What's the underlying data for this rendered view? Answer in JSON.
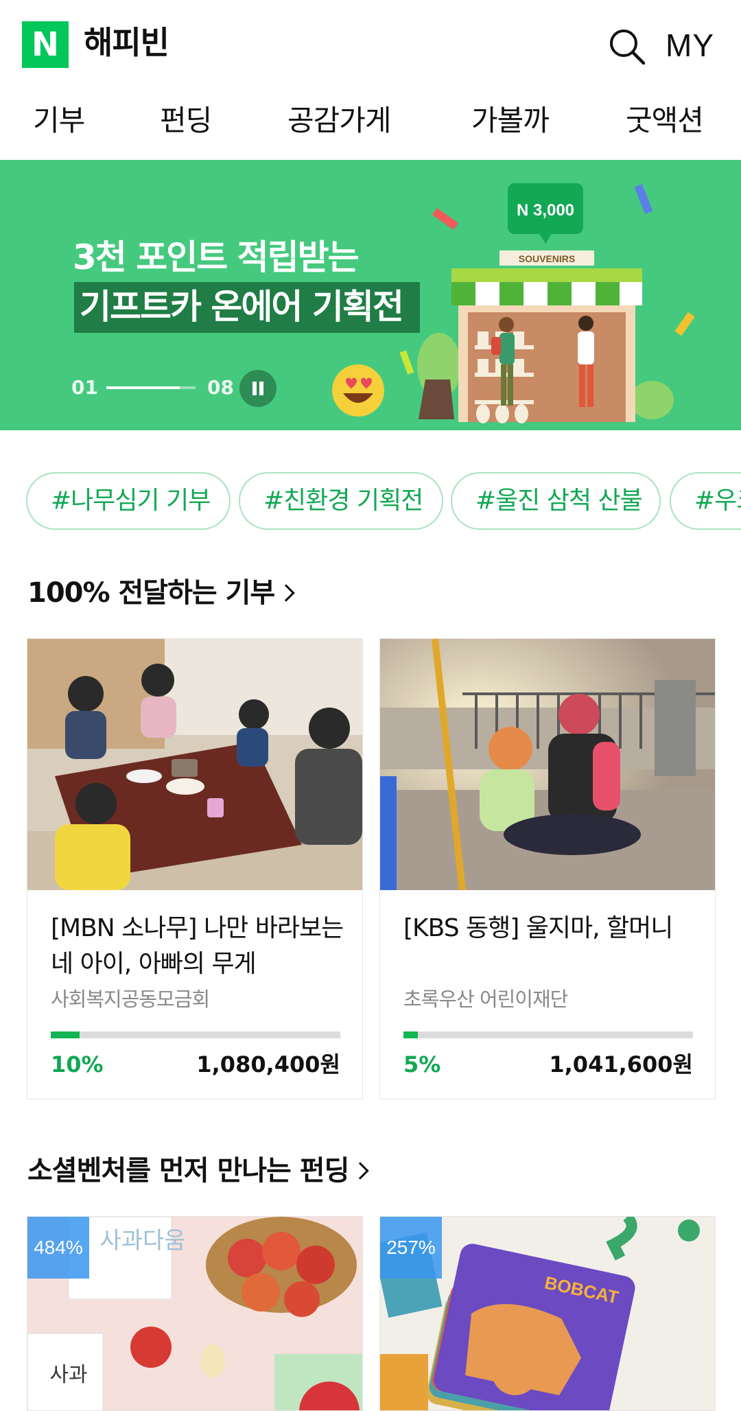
{
  "header": {
    "logo_letter": "N",
    "brand": "해피빈",
    "my_label": "MY",
    "brand_color": "#03c75a"
  },
  "nav": {
    "items": [
      "기부",
      "펀딩",
      "공감가게",
      "가볼까",
      "굿액션"
    ]
  },
  "banner": {
    "line1": "3천 포인트 적립받는",
    "line2": "기프트카 온에어 기획전",
    "slide_current": "01",
    "slide_total": "08",
    "progress": 0.82,
    "price_tag": "N 3,000",
    "shop_sign": "SOUVENIRS",
    "bg_color": "#45c97f"
  },
  "tags": [
    "#나무심기 기부",
    "#친환경 기획전",
    "#울진 삼척 산불",
    "#우크"
  ],
  "donate_section": {
    "title": "100% 전달하는 기부",
    "cards": [
      {
        "title": "[MBN 소나무] 나만 바라보는 네 아이, 아빠의 무게",
        "org": "사회복지공동모금회",
        "percent_label": "10%",
        "percent": 10,
        "amount": "1,080,400원"
      },
      {
        "title": "[KBS 동행] 울지마, 할머니",
        "org": "초록우산 어린이재단",
        "percent_label": "5%",
        "percent": 5,
        "amount": "1,041,600원"
      }
    ]
  },
  "funding_section": {
    "title": "소셜벤처를 먼저 만나는 펀딩",
    "cards": [
      {
        "badge": "484%",
        "image_text": "사과다움",
        "sub_text": "사과"
      },
      {
        "badge": "257%",
        "image_text": "BOBCAT"
      }
    ]
  },
  "accent_green": "#12a854"
}
